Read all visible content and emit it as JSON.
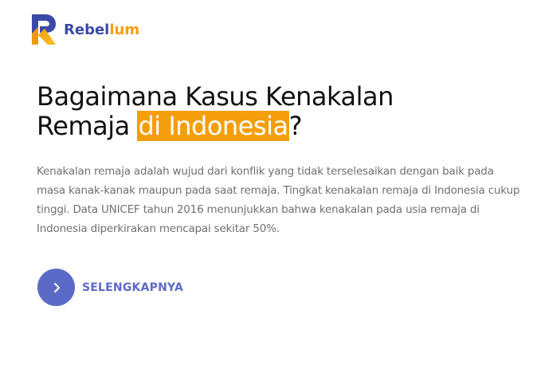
{
  "brand": {
    "name_part1": "Rebel",
    "name_part2": "lum",
    "logo_icon": "rebellum-logo-icon",
    "colors": {
      "primary": "#3b4aa8",
      "accent": "#f59e0b"
    }
  },
  "hero": {
    "title_line1": "Bagaimana Kasus Kenakalan",
    "title_line2_prefix": "Remaja ",
    "title_highlight": "di Indonesia",
    "title_suffix": "?",
    "highlight_color": "#f59e0b",
    "description": "Kenakalan remaja adalah wujud dari konflik yang tidak terselesaikan dengan baik pada masa kanak-kanak maupun pada saat remaja. Tingkat kenakalan remaja di Indonesia cukup tinggi. Data UNICEF tahun 2016 menunjukkan bahwa kenakalan pada usia remaja di Indonesia diperkirakan mencapai sekitar 50%."
  },
  "cta": {
    "label": "SELENGKAPNYA",
    "icon": "chevron-right-icon",
    "color": "#5c6ac7"
  }
}
